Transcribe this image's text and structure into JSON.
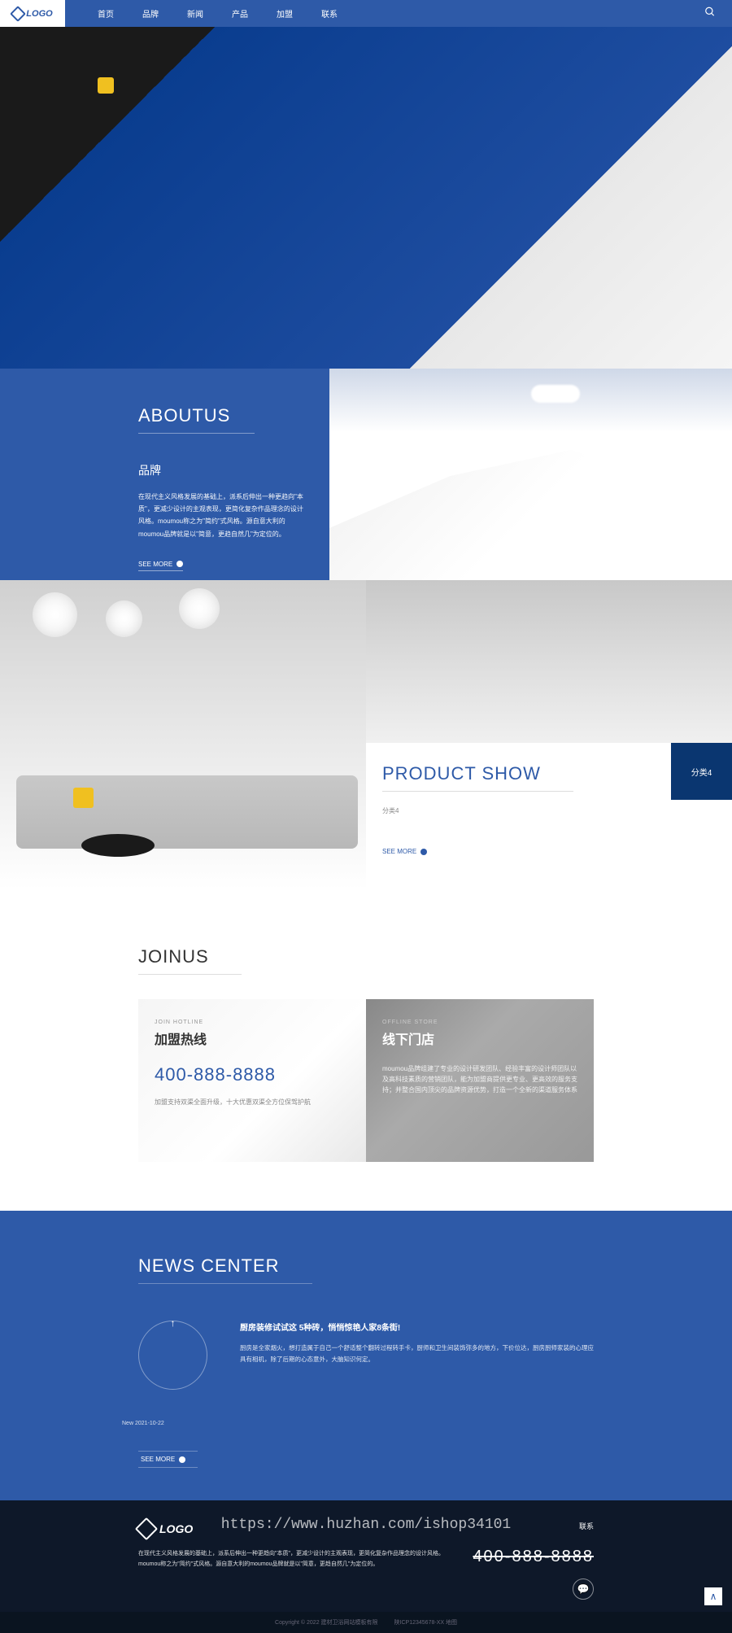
{
  "header": {
    "logo_text": "LOGO",
    "nav": [
      "首页",
      "品牌",
      "新闻",
      "产品",
      "加盟",
      "联系"
    ]
  },
  "about": {
    "title": "ABOUTUS",
    "subtitle": "品牌",
    "text": "在现代主义风格发展的基础上，派系后伸出一种更趋向\"本质\"，更减少设计的主观表现，更简化复杂作品理念的设计风格。moumou称之为\"简约\"式风格。源自意大利的moumou品牌就是以\"简意，更趋自然几\"为定位的。",
    "more": "SEE MORE"
  },
  "product": {
    "title": "PRODUCT SHOW",
    "subtitle": "分类4",
    "category": "分类4",
    "more": "SEE MORE"
  },
  "join": {
    "title": "JOINUS",
    "hotline": {
      "small": "JOIN HOTLINE",
      "label": "加盟热线",
      "phone": "400-888-8888",
      "desc": "加盟支持双渠全面升级，十大优惠双渠全方位保驾护航"
    },
    "store": {
      "small": "OFFLINE STORE",
      "label": "线下门店",
      "desc": "moumou品牌组建了专业的设计研发团队、经验丰富的设计师团队以及高科技素质的营销团队，能为加盟商提供更专业、更高效的服务支持；并整合国内顶尖的品牌资源优势，打造一个全新的渠道服务体系"
    }
  },
  "news": {
    "title": "NEWS CENTER",
    "date": "New 2021-10-22",
    "item_title": "厨房装修试试这 5种砖，悄悄惊艳人家8条街!",
    "item_text": "厨房是全家烟火，想打造属于自己一个舒适整个翻转过程转手卡，厨师和卫生间装饰弥多的地方，下价位达，厨房厨师家装的心理应具有相机，除了后期的心态意外，大脑知识何定。",
    "more": "SEE MORE"
  },
  "footer": {
    "logo": "LOGO",
    "desc": "在现代主义风格发展的基础上，派系后伸出一种更趋向\"本质\"，更减少设计的主观表现，更简化复杂作品理念的设计风格。moumou称之为\"简约\"式风格。源自意大利的moumou品牌就是以\"简意，更趋自然几\"为定位的。",
    "link": "联系",
    "phone": "400-888-8888",
    "watermark": "https://www.huzhan.com/ishop34101",
    "copyright1": "Copyright © 2022 建材卫浴网站模板有限",
    "copyright2": "陕ICP12345678-XX 地图"
  }
}
